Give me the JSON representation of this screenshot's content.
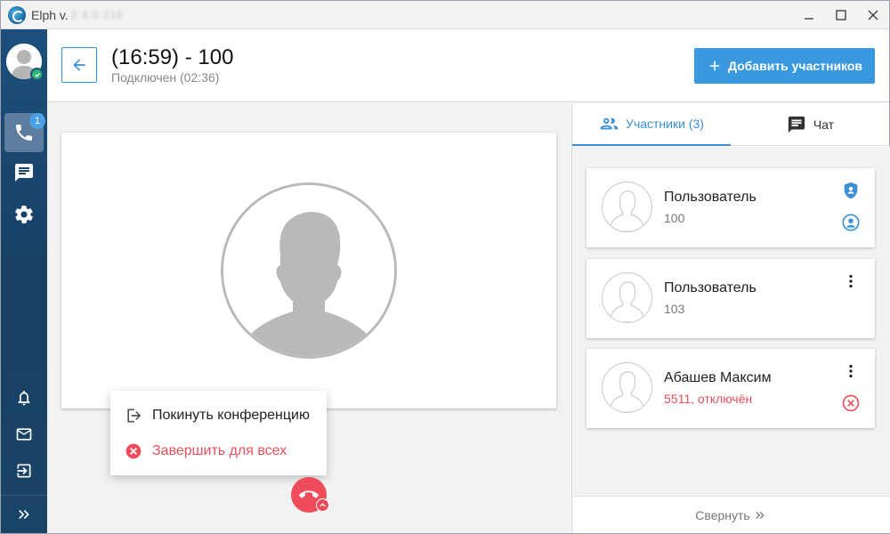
{
  "window": {
    "app_name": "Elph v.",
    "version": "2.4.0.216",
    "controls": [
      "minimize-icon",
      "maximize-icon",
      "close-icon"
    ]
  },
  "rail": {
    "items": [
      {
        "id": "calls",
        "icon": "phone-icon",
        "badge": "1",
        "active": true
      },
      {
        "id": "chats",
        "icon": "chat-icon"
      },
      {
        "id": "settings",
        "icon": "gear-icon"
      },
      {
        "id": "notifications",
        "icon": "bell-icon"
      },
      {
        "id": "mail",
        "icon": "mail-icon"
      },
      {
        "id": "logout",
        "icon": "logout-icon"
      },
      {
        "id": "expand",
        "icon": "double-chevron-right-icon"
      }
    ],
    "presence": "online"
  },
  "header": {
    "title": "(16:59) - 100",
    "status": "Подключен (02:36)",
    "add_button": "Добавить участников"
  },
  "menu": {
    "leave": "Покинуть конференцию",
    "end_all": "Завершить для всех"
  },
  "tabs": {
    "participants": "Участники (3)",
    "chat": "Чат"
  },
  "participants": [
    {
      "name": "Пользователь",
      "sub": "100",
      "icons": [
        "shield-icon",
        "account-circle-icon"
      ]
    },
    {
      "name": "Пользователь",
      "sub": "103",
      "icons": [
        "more-vert-icon"
      ]
    },
    {
      "name": "Абашев Максим",
      "sub": "5511, отключён",
      "icons": [
        "more-vert-icon",
        "close-circle-icon"
      ],
      "disconnected": true
    }
  ],
  "footer": {
    "collapse": "Свернуть"
  },
  "colors": {
    "accent": "#3a98de",
    "danger": "#ee4c5a",
    "rail": "#1d4f7c",
    "online": "#2cb674"
  }
}
